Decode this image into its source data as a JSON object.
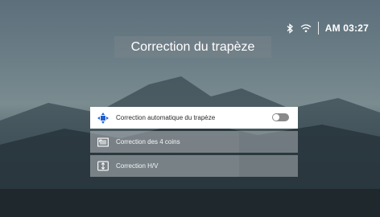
{
  "status": {
    "bluetooth_icon": "bluetooth-icon",
    "wifi_icon": "wifi-icon",
    "time": "AM 03:27"
  },
  "page": {
    "title": "Correction du trapèze"
  },
  "menu": {
    "items": [
      {
        "label": "Correction automatique du trapèze",
        "icon": "auto-keystone-icon",
        "selected": true,
        "toggle_on": false
      },
      {
        "label": "Correction des 4 coins",
        "icon": "four-corners-icon",
        "selected": false
      },
      {
        "label": "Correction H/V",
        "icon": "hv-correction-icon",
        "selected": false
      }
    ]
  },
  "colors": {
    "accent": "#1f5fd6",
    "toggle_off": "#8a8a8a"
  }
}
